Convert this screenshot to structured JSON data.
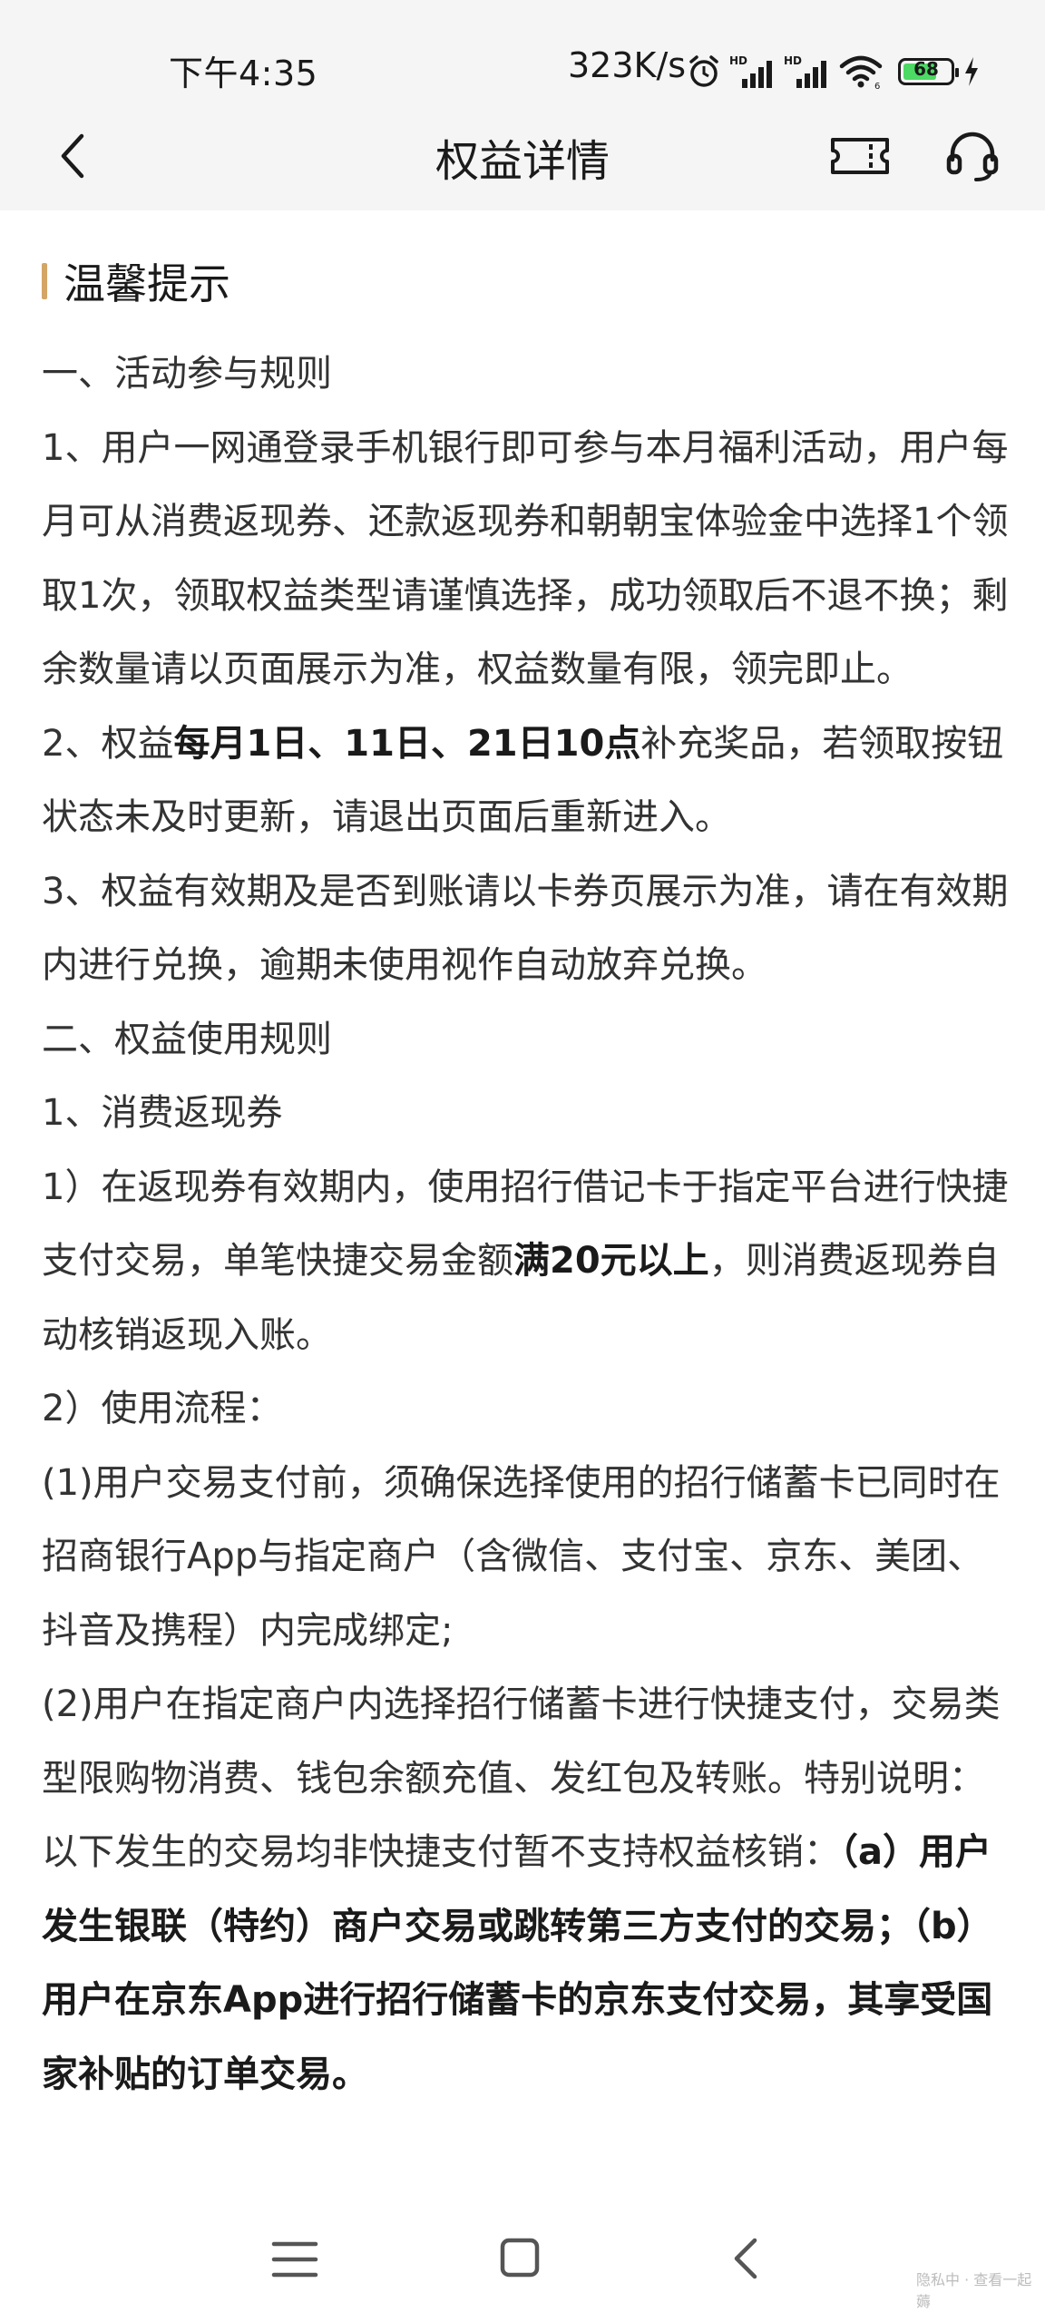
{
  "status_bar": {
    "time": "下午4:35",
    "network_speed": "323K/s",
    "battery_level": "68",
    "icons": [
      "alarm-icon",
      "hd-signal-icon",
      "hd-signal-icon",
      "wifi-icon",
      "battery-icon",
      "charging-icon"
    ]
  },
  "nav": {
    "title": "权益详情",
    "back_icon": "back-arrow-icon",
    "ticket_icon": "ticket-icon",
    "service_icon": "headset-icon"
  },
  "section": {
    "title": "温馨提示",
    "accent_color": "#d4a565"
  },
  "paragraphs": [
    {
      "segments": [
        {
          "text": "一、活动参与规则",
          "bold": false
        }
      ]
    },
    {
      "segments": [
        {
          "text": "1、用户一网通登录手机银行即可参与本月福利活动，用户每月可从消费返现券、还款返现券和朝朝宝体验金中选择1个领取1次，领取权益类型请谨慎选择，成功领取后不退不换；剩余数量请以页面展示为准，权益数量有限，领完即止。",
          "bold": false
        }
      ]
    },
    {
      "segments": [
        {
          "text": "2、权益",
          "bold": false
        },
        {
          "text": "每月1日、11日、21日10点",
          "bold": true
        },
        {
          "text": "补充奖品，若领取按钮状态未及时更新，请退出页面后重新进入。",
          "bold": false
        }
      ]
    },
    {
      "segments": [
        {
          "text": "3、权益有效期及是否到账请以卡券页展示为准，请在有效期内进行兑换，逾期未使用视作自动放弃兑换。",
          "bold": false
        }
      ]
    },
    {
      "segments": [
        {
          "text": "二、权益使用规则",
          "bold": false
        }
      ]
    },
    {
      "segments": [
        {
          "text": "1、消费返现券",
          "bold": false
        }
      ]
    },
    {
      "segments": [
        {
          "text": "1）在返现券有效期内，使用招行借记卡于指定平台进行快捷支付交易，单笔快捷交易金额",
          "bold": false
        },
        {
          "text": "满20元以上",
          "bold": true
        },
        {
          "text": "，则消费返现券自动核销返现入账。",
          "bold": false
        }
      ]
    },
    {
      "segments": [
        {
          "text": "2）使用流程：",
          "bold": false
        }
      ]
    },
    {
      "segments": [
        {
          "text": "(1)用户交易支付前，须确保选择使用的招行储蓄卡已同时在招商银行App与指定商户（含微信、支付宝、京东、美团、抖音及携程）内完成绑定;",
          "bold": false
        }
      ]
    },
    {
      "segments": [
        {
          "text": "(2)用户在指定商户内选择招行储蓄卡进行快捷支付，交易类型限购物消费、钱包余额充值、发红包及转账。特别说明：以下发生的交易均非快捷支付暂不支持权益核销：",
          "bold": false
        },
        {
          "text": "（a）用户发生银联（特约）商户交易或跳转第三方支付的交易；（b）用户在京东App进行招行储蓄卡的京东支付交易，其享受国家补贴的订单交易。",
          "bold": true
        }
      ]
    }
  ],
  "bottom_nav": {
    "icons": [
      "menu-icon",
      "home-icon",
      "back-icon"
    ]
  },
  "watermark": "隐私中 · 查看一起薅"
}
